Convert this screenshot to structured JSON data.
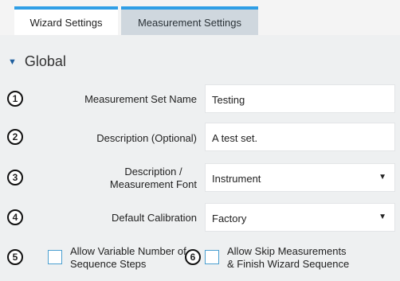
{
  "tabs": {
    "wizard": "Wizard Settings",
    "measurement": "Measurement Settings"
  },
  "section": {
    "title": "Global"
  },
  "fields": {
    "set_name": {
      "number": "1",
      "label": "Measurement Set Name",
      "value": "Testing"
    },
    "description": {
      "number": "2",
      "label": "Description (Optional)",
      "value": "A test set."
    },
    "font": {
      "number": "3",
      "label_line1": "Description /",
      "label_line2": "Measurement Font",
      "value": "Instrument"
    },
    "calibration": {
      "number": "4",
      "label": "Default Calibration",
      "value": "Factory"
    }
  },
  "options": {
    "variable_steps": {
      "number": "5",
      "line1": "Allow Variable Number of",
      "line2": "Sequence Steps",
      "checked": false
    },
    "skip_measurements": {
      "number": "6",
      "line1": "Allow Skip Measurements",
      "line2": "& Finish Wizard Sequence",
      "checked": false
    }
  },
  "colors": {
    "accent": "#2f9ee6",
    "tab_inactive": "#cfd7de",
    "panel": "#eef0f1"
  }
}
